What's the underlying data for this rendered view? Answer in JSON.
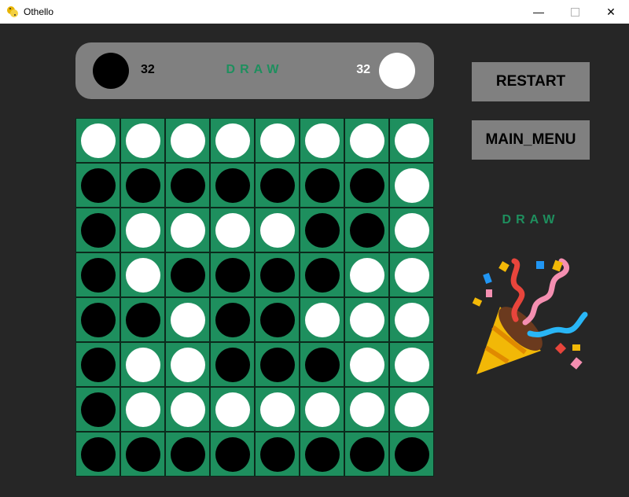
{
  "window": {
    "title": "Othello",
    "minimize": "—",
    "close": "✕"
  },
  "colors": {
    "board": "#1e8f5e",
    "panel": "#808080",
    "background": "#262626",
    "status": "#1e8f5e"
  },
  "score": {
    "black": "32",
    "white": "32",
    "status": "DRAW"
  },
  "buttons": {
    "restart": "RESTART",
    "main_menu": "MAIN_MENU"
  },
  "result": {
    "text": "DRAW",
    "icon": "party-popper-icon"
  },
  "board": [
    [
      "W",
      "W",
      "W",
      "W",
      "W",
      "W",
      "W",
      "W"
    ],
    [
      "B",
      "B",
      "B",
      "B",
      "B",
      "B",
      "B",
      "W"
    ],
    [
      "B",
      "W",
      "W",
      "W",
      "W",
      "B",
      "B",
      "W"
    ],
    [
      "B",
      "W",
      "B",
      "B",
      "B",
      "B",
      "W",
      "W"
    ],
    [
      "B",
      "B",
      "W",
      "B",
      "B",
      "W",
      "W",
      "W"
    ],
    [
      "B",
      "W",
      "W",
      "B",
      "B",
      "B",
      "W",
      "W"
    ],
    [
      "B",
      "W",
      "W",
      "W",
      "W",
      "W",
      "W",
      "W"
    ],
    [
      "B",
      "B",
      "B",
      "B",
      "B",
      "B",
      "B",
      "B"
    ]
  ]
}
